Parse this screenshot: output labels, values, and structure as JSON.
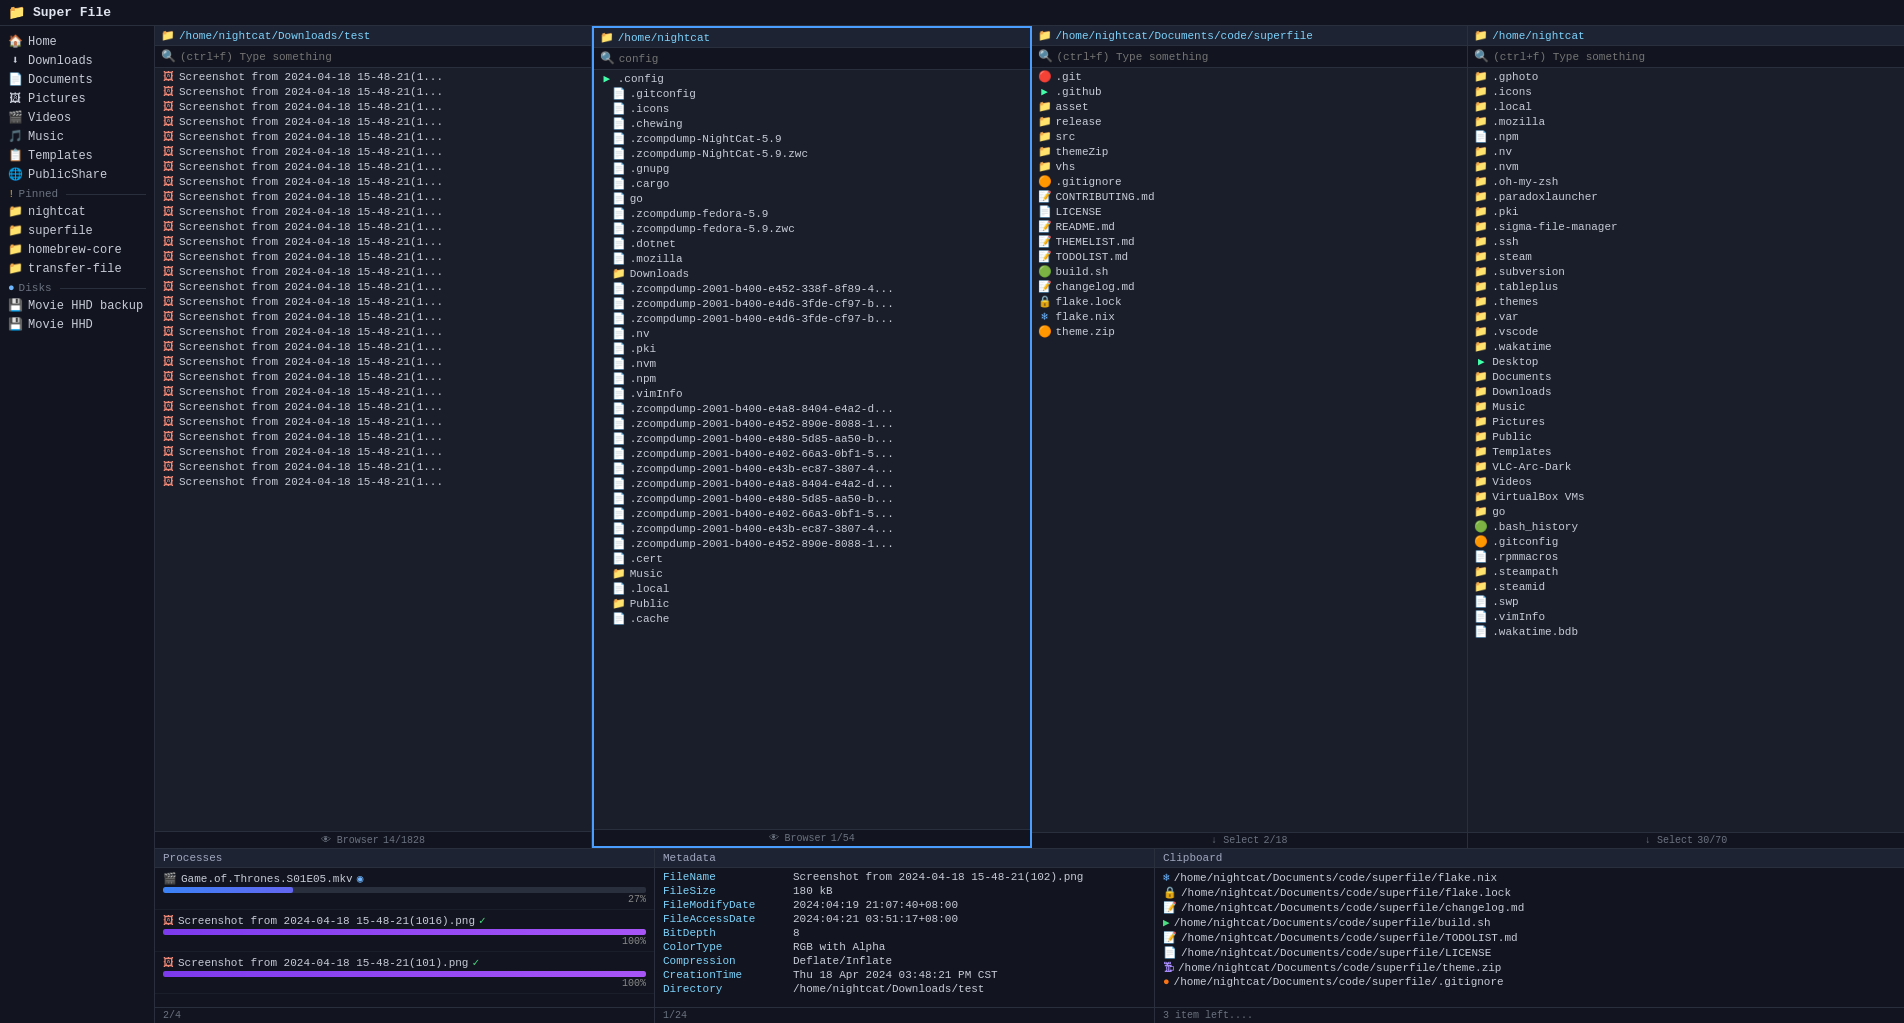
{
  "topbar": {
    "icon": "📁",
    "title": "Super File"
  },
  "sidebar": {
    "places": [
      {
        "icon": "🏠",
        "label": "Home",
        "name": "home"
      },
      {
        "icon": "⬇",
        "label": "Downloads",
        "name": "downloads"
      },
      {
        "icon": "📄",
        "label": "Documents",
        "name": "documents"
      },
      {
        "icon": "🖼",
        "label": "Pictures",
        "name": "pictures"
      },
      {
        "icon": "🎬",
        "label": "Videos",
        "name": "videos"
      },
      {
        "icon": "🎵",
        "label": "Music",
        "name": "music"
      },
      {
        "icon": "📋",
        "label": "Templates",
        "name": "templates"
      },
      {
        "icon": "🌐",
        "label": "PublicShare",
        "name": "publicshare"
      }
    ],
    "pinned_label": "Pinned",
    "pinned": [
      {
        "label": "nightcat"
      },
      {
        "label": "superfile"
      },
      {
        "label": "homebrew-core"
      },
      {
        "label": "transfer-file"
      }
    ],
    "disks_label": "Disks",
    "disks": [
      {
        "label": "Movie HHD backup"
      },
      {
        "label": "Movie HHD"
      }
    ]
  },
  "panels": [
    {
      "id": "panel1",
      "path": "/home/nightcat/Downloads/test",
      "search_placeholder": "(ctrl+f) Type something",
      "active": false,
      "files": [
        {
          "icon": "🖼",
          "type": "img",
          "name": "Screenshot from 2024-04-18 15-48-21(1..."
        },
        {
          "icon": "🖼",
          "type": "img",
          "name": "Screenshot from 2024-04-18 15-48-21(1..."
        },
        {
          "icon": "🖼",
          "type": "img",
          "name": "Screenshot from 2024-04-18 15-48-21(1..."
        },
        {
          "icon": "🖼",
          "type": "img",
          "name": "Screenshot from 2024-04-18 15-48-21(1..."
        },
        {
          "icon": "🖼",
          "type": "img",
          "name": "Screenshot from 2024-04-18 15-48-21(1..."
        },
        {
          "icon": "🖼",
          "type": "img",
          "name": "Screenshot from 2024-04-18 15-48-21(1..."
        },
        {
          "icon": "🖼",
          "type": "img",
          "name": "Screenshot from 2024-04-18 15-48-21(1..."
        },
        {
          "icon": "🖼",
          "type": "img",
          "name": "Screenshot from 2024-04-18 15-48-21(1..."
        },
        {
          "icon": "🖼",
          "type": "img",
          "name": "Screenshot from 2024-04-18 15-48-21(1..."
        },
        {
          "icon": "🖼",
          "type": "img",
          "name": "Screenshot from 2024-04-18 15-48-21(1..."
        },
        {
          "icon": "🖼",
          "type": "img",
          "name": "Screenshot from 2024-04-18 15-48-21(1..."
        },
        {
          "icon": "🖼",
          "type": "img",
          "name": "Screenshot from 2024-04-18 15-48-21(1..."
        },
        {
          "icon": "🖼",
          "type": "img",
          "name": "Screenshot from 2024-04-18 15-48-21(1..."
        },
        {
          "icon": "🖼",
          "type": "img",
          "name": "Screenshot from 2024-04-18 15-48-21(1..."
        },
        {
          "icon": "🖼",
          "type": "img",
          "name": "Screenshot from 2024-04-18 15-48-21(1..."
        },
        {
          "icon": "🖼",
          "type": "img",
          "name": "Screenshot from 2024-04-18 15-48-21(1..."
        },
        {
          "icon": "🖼",
          "type": "img",
          "name": "Screenshot from 2024-04-18 15-48-21(1..."
        },
        {
          "icon": "🖼",
          "type": "img",
          "name": "Screenshot from 2024-04-18 15-48-21(1..."
        },
        {
          "icon": "🖼",
          "type": "img",
          "name": "Screenshot from 2024-04-18 15-48-21(1..."
        },
        {
          "icon": "🖼",
          "type": "img",
          "name": "Screenshot from 2024-04-18 15-48-21(1..."
        },
        {
          "icon": "🖼",
          "type": "img",
          "name": "Screenshot from 2024-04-18 15-48-21(1..."
        },
        {
          "icon": "🖼",
          "type": "img",
          "name": "Screenshot from 2024-04-18 15-48-21(1..."
        },
        {
          "icon": "🖼",
          "type": "img",
          "name": "Screenshot from 2024-04-18 15-48-21(1..."
        },
        {
          "icon": "🖼",
          "type": "img",
          "name": "Screenshot from 2024-04-18 15-48-21(1..."
        },
        {
          "icon": "🖼",
          "type": "img",
          "name": "Screenshot from 2024-04-18 15-48-21(1..."
        },
        {
          "icon": "🖼",
          "type": "img",
          "name": "Screenshot from 2024-04-18 15-48-21(1..."
        },
        {
          "icon": "🖼",
          "type": "img",
          "name": "Screenshot from 2024-04-18 15-48-21(1..."
        },
        {
          "icon": "🖼",
          "type": "img",
          "name": "Screenshot from 2024-04-18 15-48-21(1..."
        }
      ],
      "status": "Browser",
      "position": "14/1828"
    },
    {
      "id": "panel2",
      "path": "/home/nightcat",
      "search_placeholder": "config",
      "active": true,
      "files": [
        {
          "icon": "▶",
          "type": "folder-open",
          "name": ".config",
          "expanded": true
        },
        {
          "icon": "📄",
          "type": "file",
          "name": ".gitconfig",
          "indent": 1
        },
        {
          "icon": "📄",
          "type": "file",
          "name": ".icons",
          "indent": 1
        },
        {
          "icon": "📄",
          "type": "file",
          "name": ".chewing",
          "indent": 1
        },
        {
          "icon": "📄",
          "type": "file",
          "name": ".zcompdump-NightCat-5.9",
          "indent": 1
        },
        {
          "icon": "📄",
          "type": "file",
          "name": ".zcompdump-NightCat-5.9.zwc",
          "indent": 1
        },
        {
          "icon": "📄",
          "type": "file",
          "name": ".gnupg",
          "indent": 1
        },
        {
          "icon": "📄",
          "type": "file",
          "name": ".cargo",
          "indent": 1
        },
        {
          "icon": "📄",
          "type": "file",
          "name": "go",
          "indent": 1
        },
        {
          "icon": "📄",
          "type": "file",
          "name": ".zcompdump-fedora-5.9",
          "indent": 1
        },
        {
          "icon": "📄",
          "type": "file",
          "name": ".zcompdump-fedora-5.9.zwc",
          "indent": 1
        },
        {
          "icon": "📄",
          "type": "file",
          "name": ".dotnet",
          "indent": 1
        },
        {
          "icon": "📄",
          "type": "file",
          "name": ".mozilla",
          "indent": 1
        },
        {
          "icon": "📁",
          "type": "folder",
          "name": "Downloads",
          "indent": 1
        },
        {
          "icon": "📄",
          "type": "file",
          "name": ".zcompdump-2001-b400-e452-338f-8f89-4...",
          "indent": 1
        },
        {
          "icon": "📄",
          "type": "file",
          "name": ".zcompdump-2001-b400-e4d6-3fde-cf97-b...",
          "indent": 1
        },
        {
          "icon": "📄",
          "type": "file",
          "name": ".zcompdump-2001-b400-e4d6-3fde-cf97-b...",
          "indent": 1
        },
        {
          "icon": "📄",
          "type": "file",
          "name": ".nv",
          "indent": 1
        },
        {
          "icon": "📄",
          "type": "file",
          "name": ".pki",
          "indent": 1
        },
        {
          "icon": "📄",
          "type": "file",
          "name": ".nvm",
          "indent": 1
        },
        {
          "icon": "📄",
          "type": "file",
          "name": ".npm",
          "indent": 1
        },
        {
          "icon": "📄",
          "type": "file",
          "name": ".vimInfo",
          "indent": 1
        },
        {
          "icon": "📄",
          "type": "file",
          "name": ".zcompdump-2001-b400-e4a8-8404-e4a2-d...",
          "indent": 1
        },
        {
          "icon": "📄",
          "type": "file",
          "name": ".zcompdump-2001-b400-e452-890e-8088-1...",
          "indent": 1
        },
        {
          "icon": "📄",
          "type": "file",
          "name": ".zcompdump-2001-b400-e480-5d85-aa50-b...",
          "indent": 1
        },
        {
          "icon": "📄",
          "type": "file",
          "name": ".zcompdump-2001-b400-e402-66a3-0bf1-5...",
          "indent": 1
        },
        {
          "icon": "📄",
          "type": "file",
          "name": ".zcompdump-2001-b400-e43b-ec87-3807-4...",
          "indent": 1
        },
        {
          "icon": "📄",
          "type": "file",
          "name": ".zcompdump-2001-b400-e4a8-8404-e4a2-d...",
          "indent": 1
        },
        {
          "icon": "📄",
          "type": "file",
          "name": ".zcompdump-2001-b400-e480-5d85-aa50-b...",
          "indent": 1
        },
        {
          "icon": "📄",
          "type": "file",
          "name": ".zcompdump-2001-b400-e402-66a3-0bf1-5...",
          "indent": 1
        },
        {
          "icon": "📄",
          "type": "file",
          "name": ".zcompdump-2001-b400-e43b-ec87-3807-4...",
          "indent": 1
        },
        {
          "icon": "📄",
          "type": "file",
          "name": ".zcompdump-2001-b400-e452-890e-8088-1...",
          "indent": 1
        },
        {
          "icon": "📄",
          "type": "file",
          "name": ".cert",
          "indent": 1
        },
        {
          "icon": "📁",
          "type": "folder",
          "name": "Music",
          "indent": 1
        },
        {
          "icon": "📄",
          "type": "file",
          "name": ".local",
          "indent": 1
        },
        {
          "icon": "📁",
          "type": "folder",
          "name": "Public",
          "indent": 1
        },
        {
          "icon": "📄",
          "type": "file",
          "name": ".cache",
          "indent": 1
        }
      ],
      "status": "Browser",
      "position": "1/54"
    },
    {
      "id": "panel3",
      "path": "/home/nightcat/Documents/code/superfile",
      "search_placeholder": "(ctrl+f) Type something",
      "active": false,
      "files": [
        {
          "icon": "🔴",
          "type": "git",
          "name": ".git",
          "expanded": true
        },
        {
          "icon": "▶",
          "type": "folder",
          "name": ".github",
          "expanded": true
        },
        {
          "icon": "📁",
          "type": "folder",
          "name": "asset"
        },
        {
          "icon": "📁",
          "type": "folder",
          "name": "release"
        },
        {
          "icon": "📁",
          "type": "folder",
          "name": "src"
        },
        {
          "icon": "📁",
          "type": "folder",
          "name": "themeZip"
        },
        {
          "icon": "📁",
          "type": "folder",
          "name": "vhs"
        },
        {
          "icon": "🟠",
          "type": "gitignore",
          "name": ".gitignore"
        },
        {
          "icon": "📝",
          "type": "md",
          "name": "CONTRIBUTING.md"
        },
        {
          "icon": "📄",
          "type": "license",
          "name": "LICENSE"
        },
        {
          "icon": "📝",
          "type": "md",
          "name": "README.md"
        },
        {
          "icon": "📝",
          "type": "md",
          "name": "THEMELIST.md"
        },
        {
          "icon": "📝",
          "type": "md",
          "name": "TODOLIST.md"
        },
        {
          "icon": "🟢",
          "type": "sh",
          "name": "build.sh"
        },
        {
          "icon": "📝",
          "type": "md",
          "name": "changelog.md"
        },
        {
          "icon": "🔒",
          "type": "lock",
          "name": "flake.lock"
        },
        {
          "icon": "❄",
          "type": "nix",
          "name": "flake.nix"
        },
        {
          "icon": "🟠",
          "type": "zip",
          "name": "theme.zip"
        }
      ],
      "status": "Select",
      "position": "2/18"
    },
    {
      "id": "panel4",
      "path": "/home/nightcat",
      "search_placeholder": "(ctrl+f) Type something",
      "active": false,
      "files": [
        {
          "icon": "📁",
          "type": "folder",
          "name": ".gphoto"
        },
        {
          "icon": "📁",
          "type": "folder",
          "name": ".icons"
        },
        {
          "icon": "📁",
          "type": "folder",
          "name": ".local"
        },
        {
          "icon": "📁",
          "type": "folder",
          "name": ".mozilla"
        },
        {
          "icon": "📄",
          "type": "file",
          "name": ".npm"
        },
        {
          "icon": "📁",
          "type": "folder",
          "name": ".nv"
        },
        {
          "icon": "📁",
          "type": "folder",
          "name": ".nvm"
        },
        {
          "icon": "📁",
          "type": "folder",
          "name": ".oh-my-zsh"
        },
        {
          "icon": "📁",
          "type": "folder",
          "name": ".paradoxlauncher"
        },
        {
          "icon": "📁",
          "type": "folder",
          "name": ".pki"
        },
        {
          "icon": "📁",
          "type": "folder",
          "name": ".sigma-file-manager"
        },
        {
          "icon": "📁",
          "type": "folder",
          "name": ".ssh"
        },
        {
          "icon": "📁",
          "type": "folder",
          "name": ".steam"
        },
        {
          "icon": "📁",
          "type": "folder",
          "name": ".subversion"
        },
        {
          "icon": "📁",
          "type": "folder",
          "name": ".tableplus"
        },
        {
          "icon": "📁",
          "type": "folder",
          "name": ".themes"
        },
        {
          "icon": "📁",
          "type": "folder",
          "name": ".var"
        },
        {
          "icon": "📁",
          "type": "folder",
          "name": ".vscode"
        },
        {
          "icon": "📁",
          "type": "folder",
          "name": ".wakatime"
        },
        {
          "icon": "▶",
          "type": "folder",
          "name": "Desktop",
          "expanded": true
        },
        {
          "icon": "📁",
          "type": "folder",
          "name": "Documents"
        },
        {
          "icon": "📁",
          "type": "folder",
          "name": "Downloads"
        },
        {
          "icon": "📁",
          "type": "folder",
          "name": "Music"
        },
        {
          "icon": "📁",
          "type": "folder",
          "name": "Pictures"
        },
        {
          "icon": "📁",
          "type": "folder",
          "name": "Public"
        },
        {
          "icon": "📁",
          "type": "folder",
          "name": "Templates"
        },
        {
          "icon": "📁",
          "type": "folder",
          "name": "VLC-Arc-Dark"
        },
        {
          "icon": "📁",
          "type": "folder",
          "name": "Videos"
        },
        {
          "icon": "📁",
          "type": "folder",
          "name": "VirtualBox VMs"
        },
        {
          "icon": "📁",
          "type": "folder",
          "name": "go"
        },
        {
          "icon": "🟢",
          "type": "history",
          "name": ".bash_history"
        },
        {
          "icon": "🟠",
          "type": "cfg",
          "name": ".gitconfig"
        },
        {
          "icon": "📄",
          "type": "file",
          "name": ".rpmmacros"
        },
        {
          "icon": "📁",
          "type": "folder",
          "name": ".steampath"
        },
        {
          "icon": "📁",
          "type": "folder",
          "name": ".steamid"
        },
        {
          "icon": "📄",
          "type": "file",
          "name": ".swp"
        },
        {
          "icon": "📄",
          "type": "file",
          "name": ".vimInfo"
        },
        {
          "icon": "📄",
          "type": "file",
          "name": ".wakatime.bdb"
        }
      ],
      "status": "Select",
      "position": "30/70"
    }
  ],
  "processes": {
    "header": "Processes",
    "items": [
      {
        "name": "Game.of.Thrones.S01E05.mkv",
        "type": "video",
        "check": false,
        "pct": 27
      },
      {
        "name": "Screenshot from 2024-04-18 15-48-21(1016).png",
        "type": "img",
        "check": true,
        "pct": 100
      },
      {
        "name": "Screenshot from 2024-04-18 15-48-21(101).png",
        "type": "img",
        "check": true,
        "pct": 100
      }
    ],
    "count": "2/4"
  },
  "metadata": {
    "header": "Metadata",
    "rows": [
      {
        "key": "FileName",
        "val": "Screenshot from 2024-04-18 15-48-21(102).png"
      },
      {
        "key": "FileSize",
        "val": "180 kB"
      },
      {
        "key": "FileModifyDate",
        "val": "2024:04:19 21:07:40+08:00"
      },
      {
        "key": "FileAccessDate",
        "val": "2024:04:21 03:51:17+08:00"
      },
      {
        "key": "BitDepth",
        "val": "8"
      },
      {
        "key": "ColorType",
        "val": "RGB with Alpha"
      },
      {
        "key": "Compression",
        "val": "Deflate/Inflate"
      },
      {
        "key": "CreationTime",
        "val": "Thu 18 Apr 2024 03:48:21 PM CST"
      },
      {
        "key": "Directory",
        "val": "/home/nightcat/Downloads/test"
      }
    ],
    "count": "1/24"
  },
  "clipboard": {
    "header": "Clipboard",
    "items": [
      {
        "icon": "❄",
        "type": "nix",
        "path": "/home/nightcat/Documents/code/superfile/flake.nix"
      },
      {
        "icon": "🔒",
        "type": "lock",
        "path": "/home/nightcat/Documents/code/superfile/flake.lock"
      },
      {
        "icon": "📝",
        "type": "md",
        "path": "/home/nightcat/Documents/code/superfile/changelog.md"
      },
      {
        "icon": "🟢",
        "type": "sh",
        "path": "/home/nightcat/Documents/code/superfile/build.sh"
      },
      {
        "icon": "📝",
        "type": "md",
        "path": "/home/nightcat/Documents/code/superfile/TODOLIST.md"
      },
      {
        "icon": "📄",
        "type": "license",
        "path": "/home/nightcat/Documents/code/superfile/LICENSE"
      },
      {
        "icon": "🟠",
        "type": "zip",
        "path": "/home/nightcat/Documents/code/superfile/theme.zip"
      },
      {
        "icon": "🟠",
        "type": "gitignore",
        "path": "/home/nightcat/Documents/code/superfile/.gitignore"
      }
    ],
    "count": "3 item left...."
  }
}
